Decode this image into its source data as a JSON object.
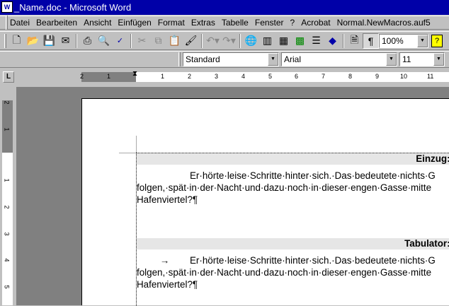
{
  "window": {
    "title": "_Name.doc - Microsoft Word",
    "app_icon": "word-icon"
  },
  "menu": [
    "Datei",
    "Bearbeiten",
    "Ansicht",
    "Einfügen",
    "Format",
    "Extras",
    "Tabelle",
    "Fenster",
    "?",
    "Acrobat",
    "Normal.NewMacros.auf5"
  ],
  "standard_toolbar": {
    "icons": [
      "new-document-icon",
      "open-folder-icon",
      "save-icon",
      "email-icon",
      "print-icon",
      "print-preview-icon",
      "spelling-icon",
      "cut-icon",
      "copy-icon",
      "paste-icon",
      "format-painter-icon",
      "undo-icon",
      "redo-icon",
      "hyperlink-icon",
      "tables-borders-icon",
      "insert-table-icon",
      "insert-excel-icon",
      "columns-icon",
      "drawing-icon",
      "document-map-icon",
      "show-formatting-icon",
      "help-icon"
    ],
    "zoom": "100%"
  },
  "formatting_toolbar": {
    "style": "Standard",
    "font": "Arial",
    "size": "11"
  },
  "ruler": {
    "horizontal_numbers": [
      "2",
      "1",
      "1",
      "2",
      "3",
      "4",
      "5",
      "6",
      "7",
      "8",
      "9",
      "10",
      "11"
    ],
    "vertical_numbers": [
      "2",
      "1",
      "1",
      "2",
      "3",
      "4",
      "5"
    ]
  },
  "document": {
    "heading1": "Einzug:¶",
    "para1": [
      "Er·hörte·leise·Schritte·hinter·sich.·Das·bedeutete·nichts·G",
      "folgen,·spät·in·der·Nacht·und·dazu·noch·in·dieser·engen·Gasse·mitte",
      "Hafenviertel?¶"
    ],
    "heading2": "Tabulator:¶",
    "tab_mark": "→",
    "para2": [
      "Er·hörte·leise·Schritte·hinter·sich.·Das·bedeutete·nichts·G",
      "folgen,·spät·in·der·Nacht·und·dazu·noch·in·dieser·engen·Gasse·mitte",
      "Hafenviertel?¶"
    ]
  }
}
